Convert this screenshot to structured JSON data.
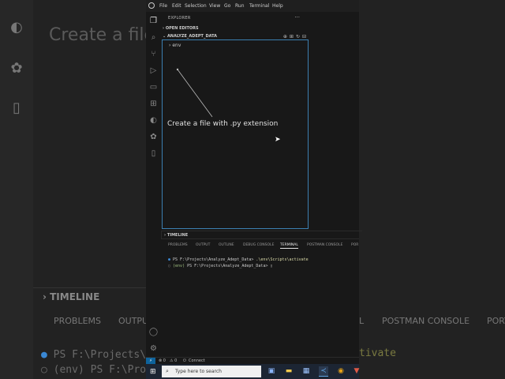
{
  "background": {
    "title": "Create a file",
    "timeline": "TIMELINE",
    "panel_tabs": [
      "PROBLEMS",
      "OUTPU"
    ],
    "panel_tabs_right": [
      "L",
      "POSTMAN CONSOLE",
      "PORT"
    ],
    "terminal_lines": [
      "PS F:\\Projects\\A",
      "(env) PS F:\\Pro"
    ],
    "terminal_right": "tivate"
  },
  "menu": [
    "File",
    "Edit",
    "Selection",
    "View",
    "Go",
    "Run",
    "Terminal",
    "Help"
  ],
  "explorer": {
    "title": "EXPLORER",
    "more": "···",
    "open_editors": "OPEN EDITORS",
    "project": "ANALYZE_ADEPT_DATA",
    "tree": [
      {
        "chevron": "›",
        "name": "env"
      }
    ]
  },
  "annotation": "Create a file with .py extension",
  "timeline": "TIMELINE",
  "panel": {
    "tabs": [
      "PROBLEMS",
      "OUTPUT",
      "OUTLINE",
      "DEBUG CONSOLE",
      "TERMINAL",
      "POSTMAN CONSOLE",
      "POR"
    ],
    "active_tab": "TERMINAL",
    "terminal": {
      "line1_prompt": "PS F:\\Projects\\Analyze_Adept_Data>",
      "line1_cmd": ".\\env\\Scripts\\activate",
      "line2_env": "(env)",
      "line2_prompt": "PS F:\\Projects\\Analyze_Adept_Data>"
    }
  },
  "statusbar": {
    "remote": "⚡",
    "errors": "⊗ 0",
    "warnings": "⚠ 0",
    "connect": "Connect"
  },
  "taskbar": {
    "search_placeholder": "Type here to search"
  },
  "colors": {
    "accent": "#0e639c",
    "tree_border": "#3c7fb1",
    "taskbar": "#1c2533"
  }
}
